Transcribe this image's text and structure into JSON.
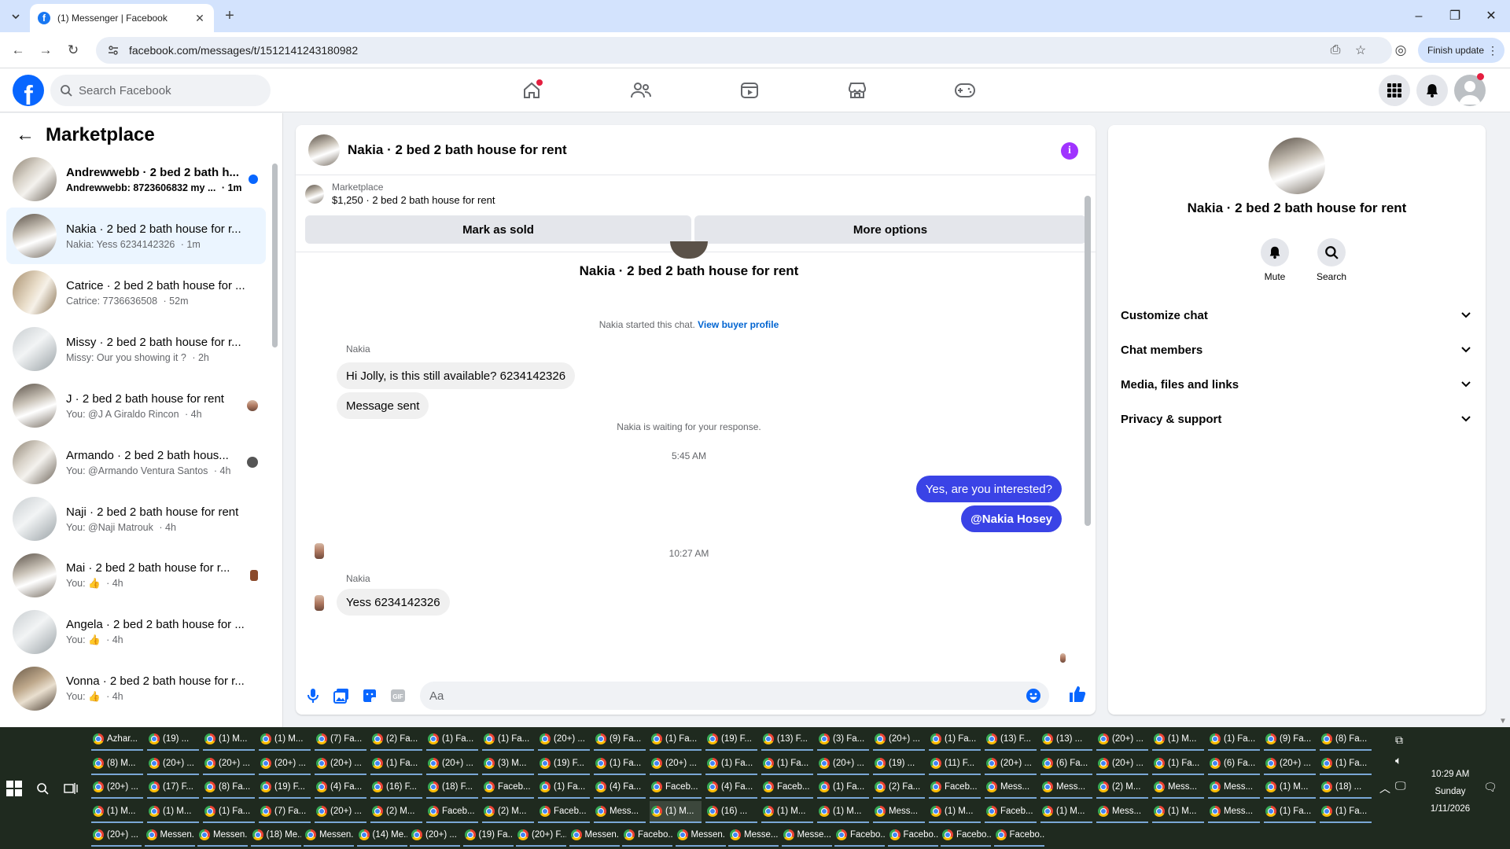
{
  "browser": {
    "tab_title": "(1) Messenger | Facebook",
    "url": "facebook.com/messages/t/1512141243180982",
    "finish_update": "Finish update"
  },
  "fb": {
    "search_placeholder": "Search Facebook"
  },
  "sidebar": {
    "title": "Marketplace",
    "conversations": [
      {
        "name": "Andrewwebb · 2 bed 2 bath h...",
        "preview": "Andrewwebb: 8723606832 my ...",
        "time": "1m",
        "unread": true
      },
      {
        "name": "Nakia · 2 bed 2 bath house for r...",
        "preview": "Nakia: Yess 6234142326",
        "time": "1m",
        "selected": true
      },
      {
        "name": "Catrice · 2 bed 2 bath house for ...",
        "preview": "Catrice: 7736636508",
        "time": "52m"
      },
      {
        "name": "Missy · 2 bed 2 bath house for r...",
        "preview": "Missy: Our you showing it ?",
        "time": "2h"
      },
      {
        "name": "J · 2 bed 2 bath house for rent",
        "preview": "You: @J A Giraldo Rincon",
        "time": "4h"
      },
      {
        "name": "Armando · 2 bed 2 bath hous...",
        "preview": "You: @Armando Ventura Santos",
        "time": "4h"
      },
      {
        "name": "Naji · 2 bed 2 bath house for rent",
        "preview": "You: @Naji Matrouk",
        "time": "4h"
      },
      {
        "name": "Mai · 2 bed 2 bath house for r...",
        "preview": "You: 👍",
        "time": "4h"
      },
      {
        "name": "Angela · 2 bed 2 bath house for ...",
        "preview": "You: 👍",
        "time": "4h"
      },
      {
        "name": "Vonna · 2 bed 2 bath house for r...",
        "preview": "You: 👍",
        "time": "4h"
      }
    ]
  },
  "chat": {
    "title": "Nakia · 2 bed 2 bath house for rent",
    "listing_source": "Marketplace",
    "listing_text": "$1,250 · 2 bed 2 bath house for rent",
    "mark_sold": "Mark as sold",
    "more_options": "More options",
    "thread_title": "Nakia · 2 bed 2 bath house for rent",
    "started_text": "Nakia started this chat.",
    "buyer_profile_link": "View buyer profile",
    "sender1": "Nakia",
    "msg1": "Hi Jolly, is this still available? 6234142326",
    "msg2": "Message sent",
    "waiting": "Nakia is waiting for your response.",
    "time1": "5:45 AM",
    "out1": "Yes, are you interested?",
    "out2": "@Nakia Hosey",
    "time2": "10:27 AM",
    "sender2": "Nakia",
    "msg3": "Yess 6234142326",
    "composer_placeholder": "Aa"
  },
  "info": {
    "name": "Nakia · 2 bed 2 bath house for rent",
    "mute": "Mute",
    "search": "Search",
    "sections": [
      "Customize chat",
      "Chat members",
      "Media, files and links",
      "Privacy & support"
    ]
  },
  "taskbar": {
    "rows": [
      [
        "Azhar...",
        "(19) ...",
        "(1) M...",
        "(1) M...",
        "(7) Fa...",
        "(2) Fa...",
        "(1) Fa...",
        "(1) Fa...",
        "(20+) ...",
        "(9) Fa...",
        "(1) Fa...",
        "(19) F...",
        "(13) F...",
        "(3) Fa...",
        "(20+) ...",
        "(1) Fa...",
        "(13) F...",
        "(13) ...",
        "(20+) ...",
        "(1) M...",
        "(1) Fa...",
        "(9) Fa...",
        "(8) Fa..."
      ],
      [
        "(8) M...",
        "(20+) ...",
        "(20+) ...",
        "(20+) ...",
        "(20+) ...",
        "(1) Fa...",
        "(20+) ...",
        "(3) M...",
        "(19) F...",
        "(1) Fa...",
        "(20+) ...",
        "(1) Fa...",
        "(1) Fa...",
        "(20+) ...",
        "(19) ...",
        "(11) F...",
        "(20+) ...",
        "(6) Fa...",
        "(20+) ...",
        "(1) Fa...",
        "(6) Fa...",
        "(20+) ...",
        "(1) Fa..."
      ],
      [
        "(20+) ...",
        "(17) F...",
        "(8) Fa...",
        "(19) F...",
        "(4) Fa...",
        "(16) F...",
        "(18) F...",
        "Faceb...",
        "(1) Fa...",
        "(4) Fa...",
        "Faceb...",
        "(4) Fa...",
        "Faceb...",
        "(1) Fa...",
        "(2) Fa...",
        "Faceb...",
        "Mess...",
        "Mess...",
        "(2) M...",
        "Mess...",
        "Mess...",
        "(1) M...",
        "(18) ..."
      ],
      [
        "(1) M...",
        "(1) M...",
        "(1) Fa...",
        "(7) Fa...",
        "(20+) ...",
        "(2) M...",
        "Faceb...",
        "(2) M...",
        "Faceb...",
        "Mess...",
        "(1) M...",
        "(16) ...",
        "(1) M...",
        "(1) M...",
        "Mess...",
        "(1) M...",
        "Faceb...",
        "(1) M...",
        "Mess...",
        "(1) M...",
        "Mess...",
        "(1) Fa...",
        "(1) Fa..."
      ],
      [
        "(20+) ...",
        "Messen...",
        "Messen...",
        "(18) Me...",
        "Messen...",
        "(14) Me...",
        "(20+) ...",
        "(19) Fa...",
        "(20+) F...",
        "Messen...",
        "Facebo...",
        "Messen...",
        "Messe...",
        "Messe...",
        "Facebo...",
        "Facebo...",
        "Facebo...",
        "Facebo..."
      ]
    ],
    "time": "10:29 AM",
    "day": "Sunday",
    "date": "1/11/2026"
  }
}
